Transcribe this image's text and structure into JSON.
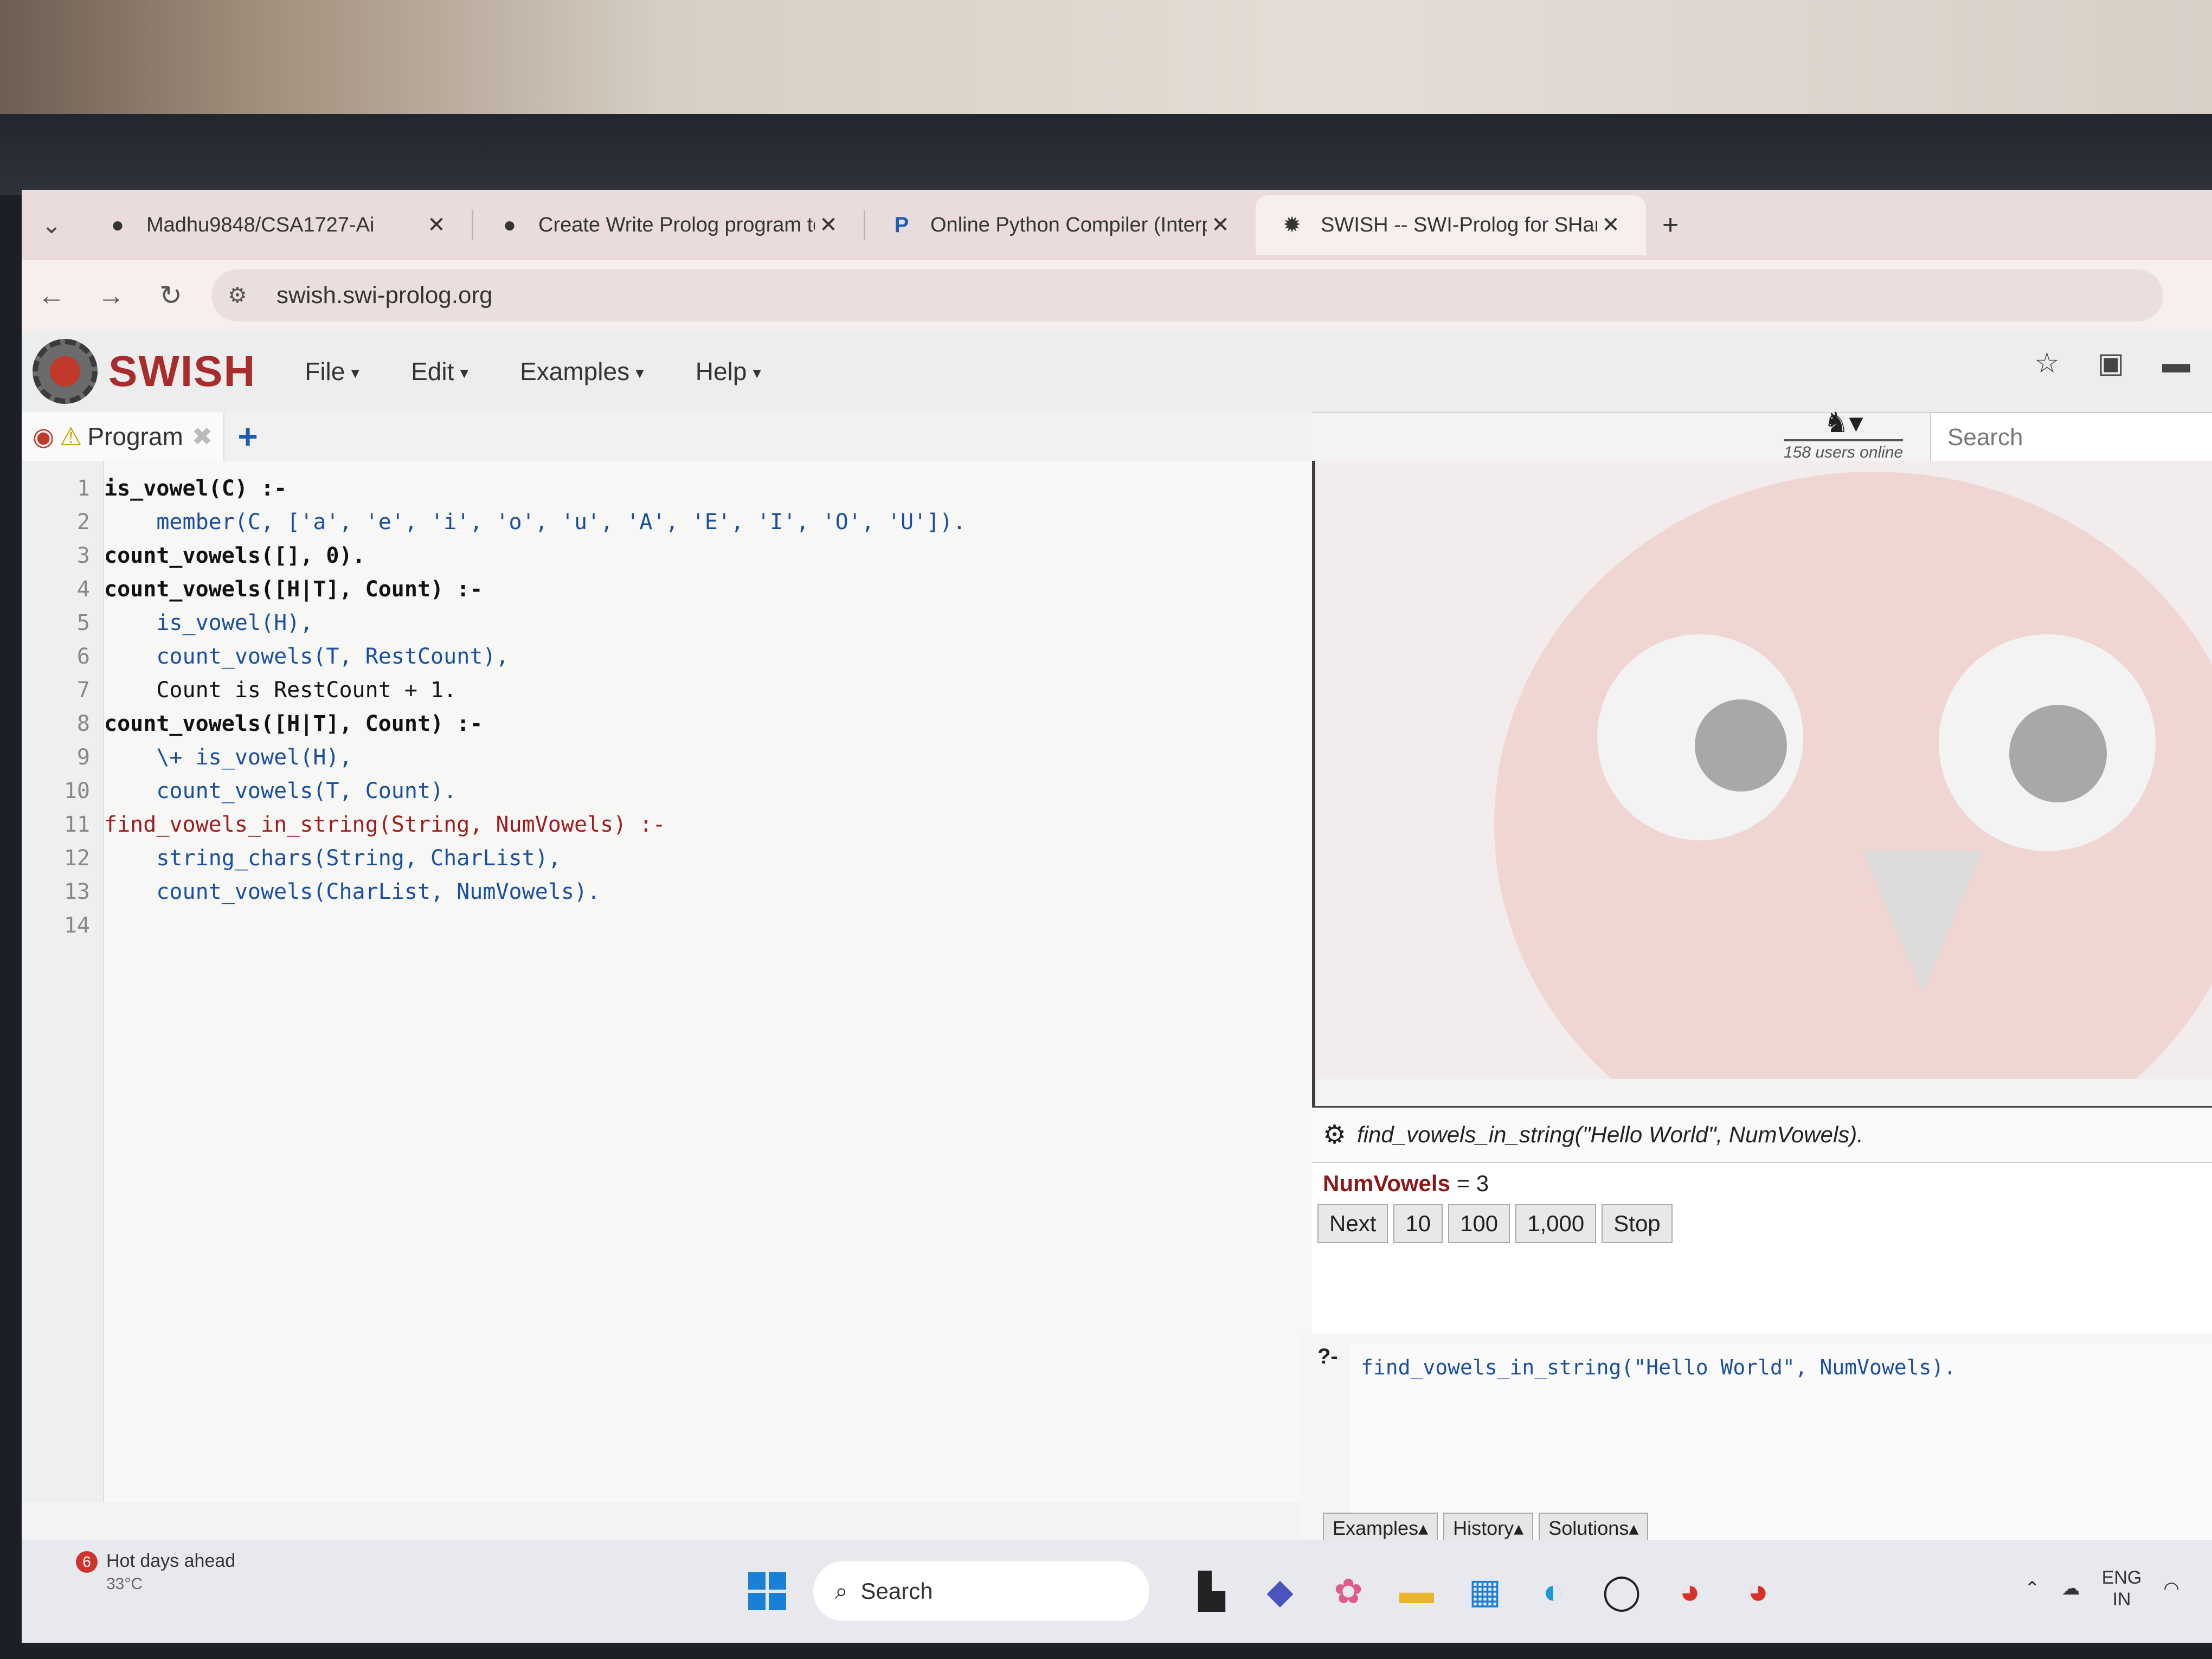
{
  "browser": {
    "tabs": [
      {
        "title": "Madhu9848/CSA1727-Ai",
        "icon": "github-icon"
      },
      {
        "title": "Create Write Prolog program to",
        "icon": "github-icon"
      },
      {
        "title": "Online Python Compiler (Interp",
        "icon": "programiz-icon"
      },
      {
        "title": "SWISH -- SWI-Prolog for SHarin",
        "icon": "swish-icon",
        "active": true
      }
    ],
    "url": "swish.swi-prolog.org"
  },
  "swish": {
    "title": "SWISH",
    "menus": [
      "File",
      "Edit",
      "Examples",
      "Help"
    ],
    "program_tab": "Program",
    "users_online": "158 users online",
    "search_placeholder": "Search"
  },
  "code": [
    {
      "n": "1",
      "text": "is_vowel(C) :-"
    },
    {
      "n": "2",
      "text": "    member(C, ['a', 'e', 'i', 'o', 'u', 'A', 'E', 'I', 'O', 'U'])."
    },
    {
      "n": "3",
      "text": "count_vowels([], 0)."
    },
    {
      "n": "4",
      "text": "count_vowels([H|T], Count) :-"
    },
    {
      "n": "5",
      "text": "    is_vowel(H),"
    },
    {
      "n": "6",
      "text": "    count_vowels(T, RestCount),"
    },
    {
      "n": "7",
      "text": "    Count is RestCount + 1."
    },
    {
      "n": "8",
      "text": "count_vowels([H|T], Count) :-"
    },
    {
      "n": "9",
      "text": "    \\+ is_vowel(H),"
    },
    {
      "n": "10",
      "text": "    count_vowels(T, Count)."
    },
    {
      "n": "11",
      "text": "find_vowels_in_string(String, NumVowels) :-"
    },
    {
      "n": "12",
      "text": "    string_chars(String, CharList),"
    },
    {
      "n": "13",
      "text": "    count_vowels(CharList, NumVowels)."
    },
    {
      "n": "14",
      "text": ""
    }
  ],
  "answer": {
    "query": "find_vowels_in_string(\"Hello World\", NumVowels).",
    "var": "NumVowels",
    "eq": " = 3",
    "buttons": [
      "Next",
      "10",
      "100",
      "1,000",
      "Stop"
    ]
  },
  "query_editor": {
    "prompt": "?-",
    "text": "find_vowels_in_string(\"Hello World\", NumVowels).",
    "buttons": [
      "Examples",
      "History",
      "Solutions"
    ]
  },
  "taskbar": {
    "weather_badge": "6",
    "weather_title": "Hot days ahead",
    "weather_temp": "33°C",
    "search": "Search",
    "lang_line1": "ENG",
    "lang_line2": "IN"
  }
}
